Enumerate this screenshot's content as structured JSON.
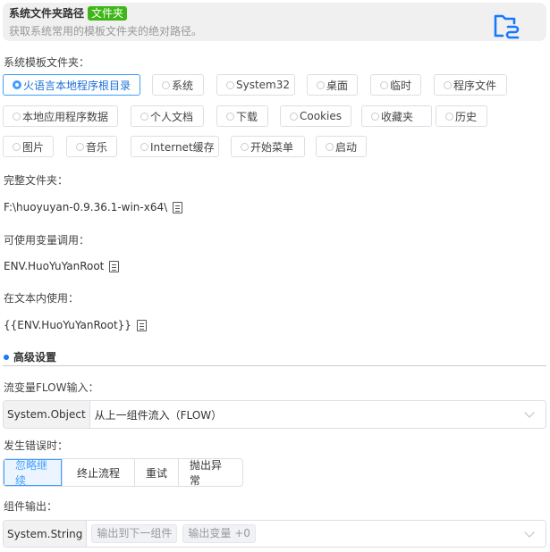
{
  "header": {
    "title": "系统文件夹路径",
    "tag": "文件夹",
    "subtitle": "获取系统常用的模板文件夹的绝对路径。",
    "icon": "folder-link-icon",
    "accent": "#1677ff"
  },
  "folder_label": "系统模板文件夹：",
  "folders": [
    {
      "label": "火语言本地程序根目录",
      "selected": true
    },
    {
      "label": "系统"
    },
    {
      "label": "System32"
    },
    {
      "label": "桌面"
    },
    {
      "label": "临时"
    },
    {
      "label": "程序文件"
    },
    {
      "label": "本地应用程序数据"
    },
    {
      "label": "个人文档"
    },
    {
      "label": "下载"
    },
    {
      "label": "Cookies"
    },
    {
      "label": "收藏夹"
    },
    {
      "label": "历史"
    },
    {
      "label": "图片"
    },
    {
      "label": "音乐"
    },
    {
      "label": "Internet缓存"
    },
    {
      "label": "开始菜单"
    },
    {
      "label": "启动"
    }
  ],
  "full_folder": {
    "label": "完整文件夹：",
    "value": "F:\\huoyuyan-0.9.36.1-win-x64\\"
  },
  "variable": {
    "label": "可使用变量调用：",
    "value": "ENV.HuoYuYanRoot"
  },
  "in_text": {
    "label": "在文本内使用：",
    "value": "{{ENV.HuoYuYanRoot}}"
  },
  "advanced": {
    "title": "高级设置"
  },
  "flow_input": {
    "label": "流变量FLOW输入：",
    "type": "System.Object",
    "value": "从上一组件流入（FLOW）"
  },
  "on_error": {
    "label": "发生错误时：",
    "options": [
      "忽略继续",
      "终止流程",
      "重试",
      "抛出异常"
    ],
    "selected": "忽略继续"
  },
  "output": {
    "label": "组件输出：",
    "type": "System.String",
    "chips": [
      "输出到下一组件",
      "输出变量 +0"
    ]
  }
}
